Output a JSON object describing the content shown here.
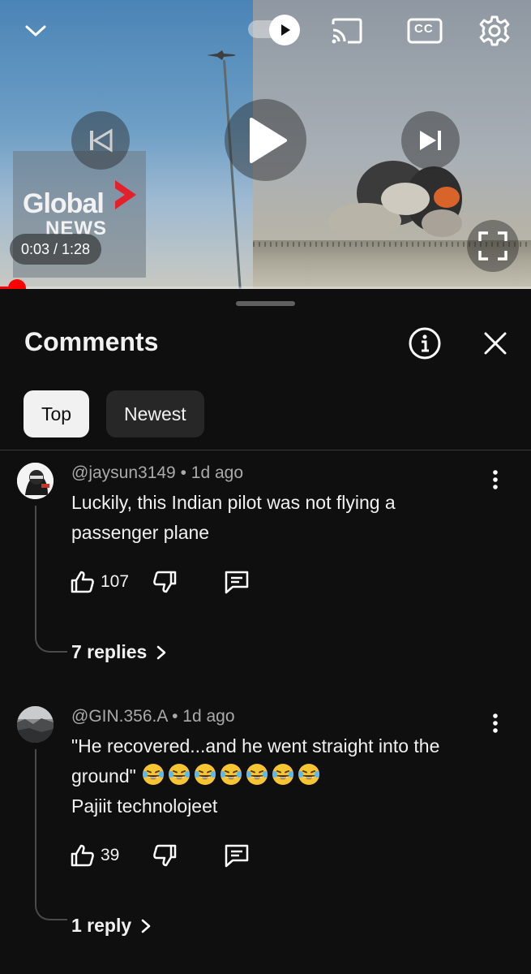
{
  "player": {
    "logo_line1": "Global",
    "logo_line2": "NEWS",
    "time": "0:03 / 1:28",
    "progress_fraction": 0.035,
    "icons": [
      "chevron-down-icon",
      "autoplay-toggle-icon",
      "cast-icon",
      "captions-icon",
      "settings-gear-icon",
      "previous-icon",
      "play-icon",
      "next-icon",
      "fullscreen-icon"
    ],
    "captions_label": "CC"
  },
  "panel": {
    "title": "Comments",
    "chips": [
      {
        "label": "Top",
        "active": true
      },
      {
        "label": "Newest",
        "active": false
      }
    ]
  },
  "comments": [
    {
      "author": "@jaysun3149",
      "age": "1d ago",
      "separator": "•",
      "text_lines": [
        "Luckily, this Indian pilot was not flying a",
        "passenger plane"
      ],
      "likes": "107",
      "replies": "7 replies"
    },
    {
      "author": "@GIN.356.A",
      "age": "1d ago",
      "separator": "•",
      "text_line1": "\"He recovered...and he went straight into the",
      "text_line2": "ground\"",
      "emoji": "😂",
      "emoji_count": 7,
      "text_line3": "Pajiit technolojeet",
      "likes": "39",
      "replies": "1 reply"
    }
  ],
  "colors": {
    "background": "#0f0f0f",
    "text": "#f1f1f1",
    "secondary_text": "#aaaaaa",
    "progress": "#ff0000",
    "chip_idle": "#272727"
  }
}
